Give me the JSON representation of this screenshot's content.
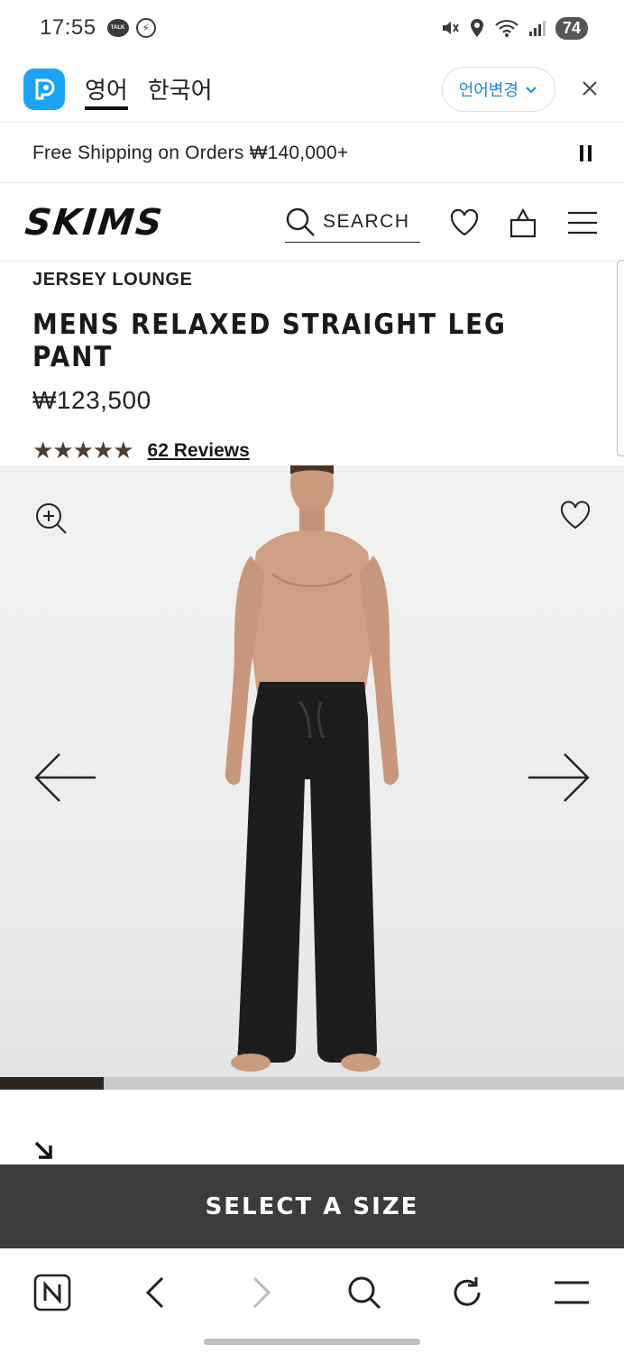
{
  "status_bar": {
    "time": "17:55",
    "talk_badge": "TALK",
    "battery": "74"
  },
  "translate_bar": {
    "tabs": [
      {
        "label": "영어",
        "active": true
      },
      {
        "label": "한국어",
        "active": false
      }
    ],
    "change_language": "언어변경",
    "close_icon": "close-icon"
  },
  "promo": {
    "text": "Free Shipping on Orders ₩140,000+"
  },
  "header": {
    "logo": "SKIMS",
    "search_label": "SEARCH"
  },
  "product": {
    "collection": "JERSEY LOUNGE",
    "title": "MENS RELAXED STRAIGHT LEG PANT",
    "price": "₩123,500",
    "rating": 5,
    "stars": "★★★★★",
    "reviews": "62 Reviews"
  },
  "gallery": {
    "progress": 0.166,
    "icons": [
      "zoom-in-icon",
      "heart-icon",
      "arrow-left-icon",
      "arrow-right-icon"
    ]
  },
  "cta": {
    "label": "SELECT A SIZE"
  },
  "browser_nav": {
    "items": [
      "naver-home-icon",
      "back-icon",
      "forward-icon",
      "search-icon",
      "refresh-icon",
      "menu-icon"
    ]
  },
  "colors": {
    "accent_blue": "#1a8ad6",
    "papago_blue": "#1ba3f5",
    "cta_bg": "#3c3c3c",
    "star_color": "#4b3f36",
    "progress_fill": "#2d2520"
  }
}
